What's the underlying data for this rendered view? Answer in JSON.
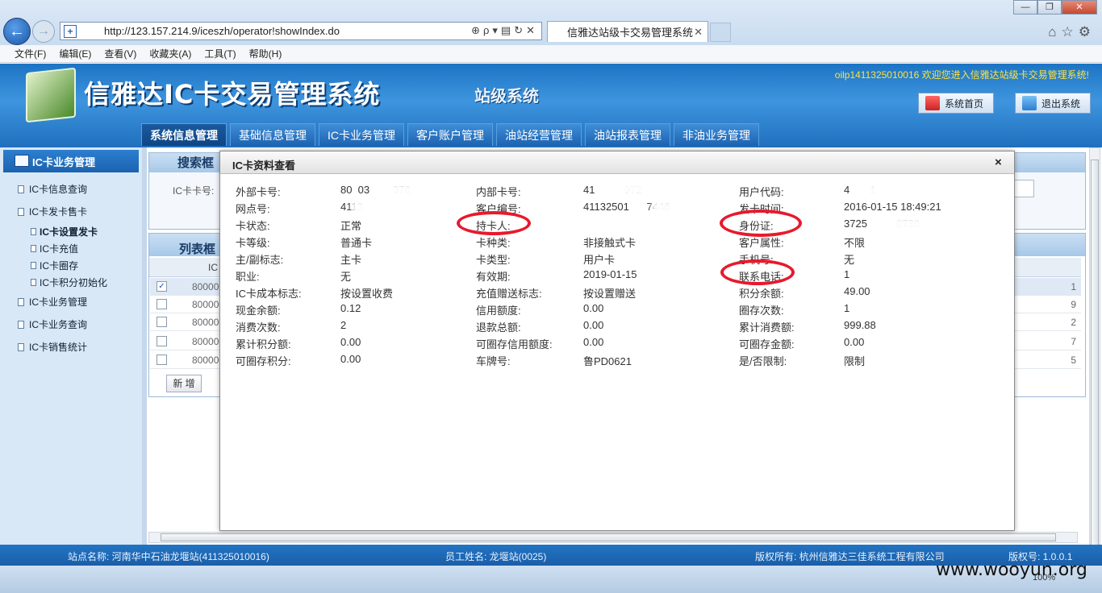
{
  "browser": {
    "address": "http://123.157.214.9/iceszh/operator!showIndex.do",
    "tab_title": "信雅达站级卡交易管理系统",
    "menu": [
      "文件(F)",
      "编辑(E)",
      "查看(V)",
      "收藏夹(A)",
      "工具(T)",
      "帮助(H)"
    ],
    "zoom": "100%"
  },
  "header": {
    "title": "信雅达IC卡交易管理系统",
    "subtitle": "站级系统",
    "welcome": "oilp1411325010016 欢迎您进入信雅达站级卡交易管理系统!",
    "home_label": "系统首页",
    "exit_label": "退出系统"
  },
  "nav_tabs": [
    "系统信息管理",
    "基础信息管理",
    "IC卡业务管理",
    "客户账户管理",
    "油站经营管理",
    "油站报表管理",
    "非油业务管理"
  ],
  "sidebar": {
    "head": "IC卡业务管理",
    "items": [
      {
        "label": "IC卡信息查询"
      },
      {
        "label": "IC卡发卡售卡"
      },
      {
        "label": "IC卡设置发卡"
      },
      {
        "label": "IC卡充值"
      },
      {
        "label": "IC卡圈存"
      },
      {
        "label": "IC卡积分初始化"
      },
      {
        "label": "IC卡业务管理"
      },
      {
        "label": "IC卡业务查询"
      },
      {
        "label": "IC卡销售统计"
      }
    ]
  },
  "search": {
    "title": "搜索框",
    "card_label": "IC卡卡号:"
  },
  "list": {
    "title": "列表框",
    "col": "IC",
    "rows": [
      {
        "prefix": "800000",
        "tail": "1",
        "checked": "✓"
      },
      {
        "prefix": "800000",
        "tail": "9",
        "checked": ""
      },
      {
        "prefix": "800000",
        "tail": "2",
        "checked": ""
      },
      {
        "prefix": "800000",
        "tail": "7",
        "checked": ""
      },
      {
        "prefix": "800000",
        "tail": "5",
        "checked": ""
      }
    ],
    "new_label": "新 增"
  },
  "modal": {
    "title": "IC卡资料查看",
    "close": "×",
    "rows": [
      [
        [
          "外部卡号:",
          "80  03        376"
        ],
        [
          "内部卡号:",
          "41          972"
        ],
        [
          "用户代码:",
          "4       1"
        ]
      ],
      [
        [
          "网点号:",
          "4113"
        ],
        [
          "客户编号:",
          "41132501      7448"
        ],
        [
          "发卡时间:",
          "2016-01-15 18:49:21"
        ]
      ],
      [
        [
          "卡状态:",
          "正常"
        ],
        [
          "持卡人:",
          ""
        ],
        [
          "身份证:",
          "3725          0730"
        ]
      ],
      [
        [
          "卡等级:",
          "普通卡"
        ],
        [
          "卡种类:",
          "非接触式卡"
        ],
        [
          "客户属性:",
          "不限"
        ]
      ],
      [
        [
          "主/副标志:",
          "主卡"
        ],
        [
          "卡类型:",
          "用户卡"
        ],
        [
          "手机号:",
          "无"
        ]
      ],
      [
        [
          "职业:",
          "无"
        ],
        [
          "有效期:",
          "2019-01-15"
        ],
        [
          "联系电话:",
          "1"
        ]
      ],
      [
        [
          "IC卡成本标志:",
          "按设置收费"
        ],
        [
          "充值赠送标志:",
          "按设置赠送"
        ],
        [
          "积分余额:",
          "49.00"
        ]
      ],
      [
        [
          "现金余额:",
          "0.12"
        ],
        [
          "信用额度:",
          "0.00"
        ],
        [
          "圈存次数:",
          "1"
        ]
      ],
      [
        [
          "消费次数:",
          "2"
        ],
        [
          "退款总额:",
          "0.00"
        ],
        [
          "累计消费额:",
          "999.88"
        ]
      ],
      [
        [
          "累计积分额:",
          "0.00"
        ],
        [
          "可圈存信用额度:",
          "0.00"
        ],
        [
          "可圈存金额:",
          "0.00"
        ]
      ],
      [
        [
          "可圈存积分:",
          "0.00"
        ],
        [
          "车牌号:",
          "鲁PD0621"
        ],
        [
          "是/否限制:",
          "限制"
        ]
      ]
    ]
  },
  "footer": {
    "station": "站点名称: 河南华中石油龙堰站(411325010016)",
    "staff": "员工姓名: 龙堰站(0025)",
    "copyright": "版权所有: 杭州信雅达三佳系统工程有限公司",
    "version": "版权号: 1.0.0.1"
  },
  "watermark": "www.wooyun.org",
  "colors": {
    "header_blue": "#1d74c4",
    "highlight_ring": "#e8192c",
    "welcome_yellow": "#ffe23a"
  }
}
